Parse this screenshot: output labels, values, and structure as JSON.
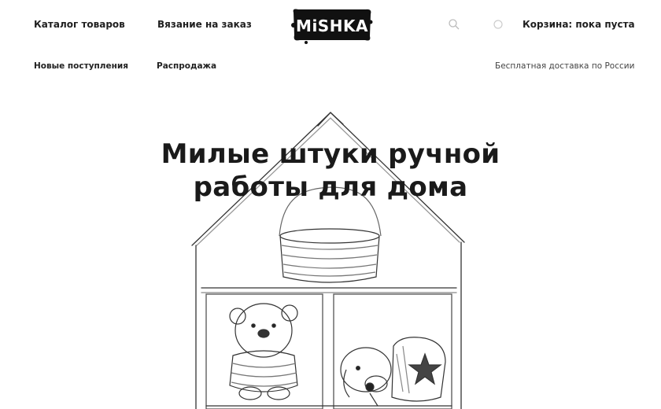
{
  "header": {
    "nav_top": {
      "catalog": "Каталог товаров",
      "knitting": "Вязание на заказ"
    },
    "nav_bottom": {
      "new_arrivals": "Новые поступления",
      "sale": "Распродажа"
    },
    "logo_text": "MiSHKA",
    "cart_label": "Корзина: пока пуста",
    "delivery_note": "Бесплатная доставка по России",
    "icons": [
      "search-icon",
      "user-icon"
    ]
  },
  "hero": {
    "title_line1": "Милые штуки ручной",
    "title_line2": "работы для дома"
  },
  "colors": {
    "text": "#1a1a1a",
    "background": "#ffffff"
  }
}
